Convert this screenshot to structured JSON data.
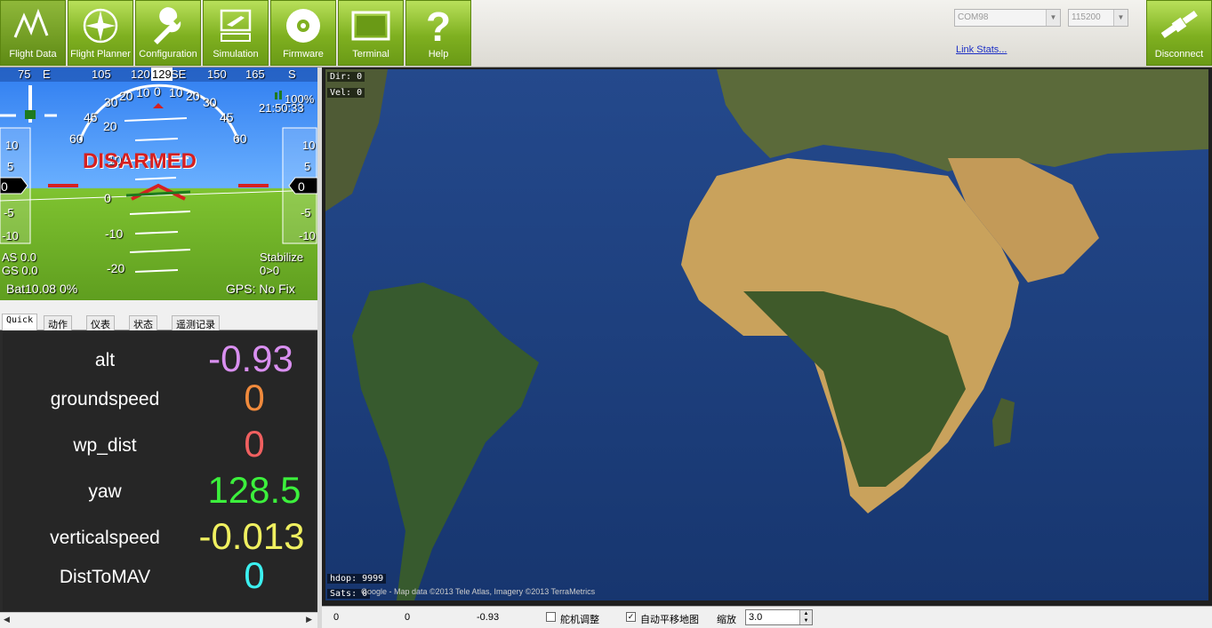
{
  "toolbar": {
    "buttons": [
      {
        "label": "Flight Data",
        "icon": "flight-data-icon"
      },
      {
        "label": "Flight Planner",
        "icon": "compass-icon"
      },
      {
        "label": "Configuration",
        "icon": "wrench-icon"
      },
      {
        "label": "Simulation",
        "icon": "simulation-icon"
      },
      {
        "label": "Firmware",
        "icon": "disc-icon"
      },
      {
        "label": "Terminal",
        "icon": "terminal-icon"
      },
      {
        "label": "Help",
        "icon": "question-icon"
      },
      {
        "label": "Disconnect",
        "icon": "satellite-icon"
      }
    ],
    "com_port": "COM98",
    "baud_rate": "115200",
    "link_stats": "Link Stats..."
  },
  "hud": {
    "heading_ticks": [
      "75",
      "E",
      "105",
      "120",
      "129",
      "SE",
      "150",
      "165",
      "S"
    ],
    "battery_remaining": "100%",
    "time": "21:50:33",
    "status_text": "DISARMED",
    "roll_labels": [
      "60",
      "45",
      "30",
      "20",
      "10",
      "0",
      "10",
      "20",
      "30",
      "45",
      "60"
    ],
    "pitch_labels": [
      "20",
      "10",
      "0",
      "-10",
      "-20"
    ],
    "left_tape": [
      "10",
      "5",
      "0",
      "-5",
      "-10"
    ],
    "right_tape": [
      "10",
      "5",
      "0",
      "-5",
      "-10"
    ],
    "airspeed": "AS 0.0",
    "groundspeed": "GS 0.0",
    "battery": "Bat10.08 0%",
    "mode": "Stabilize",
    "wp": "0>0",
    "gps": "GPS: No Fix"
  },
  "tabs": [
    "Quick",
    "动作",
    "仪表",
    "状态",
    "遥测记录"
  ],
  "quick": [
    {
      "label": "alt",
      "value": "-0.93",
      "color": "#d98ff0"
    },
    {
      "label": "groundspeed",
      "value": "0",
      "color": "#f08a3c"
    },
    {
      "label": "wp_dist",
      "value": "0",
      "color": "#f06060"
    },
    {
      "label": "yaw",
      "value": "128.5",
      "color": "#3cf03c"
    },
    {
      "label": "verticalspeed",
      "value": "-0.013",
      "color": "#f0f060"
    },
    {
      "label": "DistToMAV",
      "value": "0",
      "color": "#3cf0f0"
    }
  ],
  "map": {
    "dir": "Dir: 0",
    "vel": "Vel: 0",
    "hdop": "hdop: 9999",
    "sats": "Sats: 0",
    "attribution": "Google - Map data ©2013 Tele Atlas, Imagery ©2013 TerraMetrics"
  },
  "status_bar": {
    "lat": "0",
    "lng": "0",
    "alt": "-0.93",
    "servo_tune": "舵机调整",
    "servo_checked": false,
    "auto_pan": "自动平移地图",
    "auto_pan_checked": true,
    "zoom_label": "缩放",
    "zoom_value": "3.0"
  }
}
